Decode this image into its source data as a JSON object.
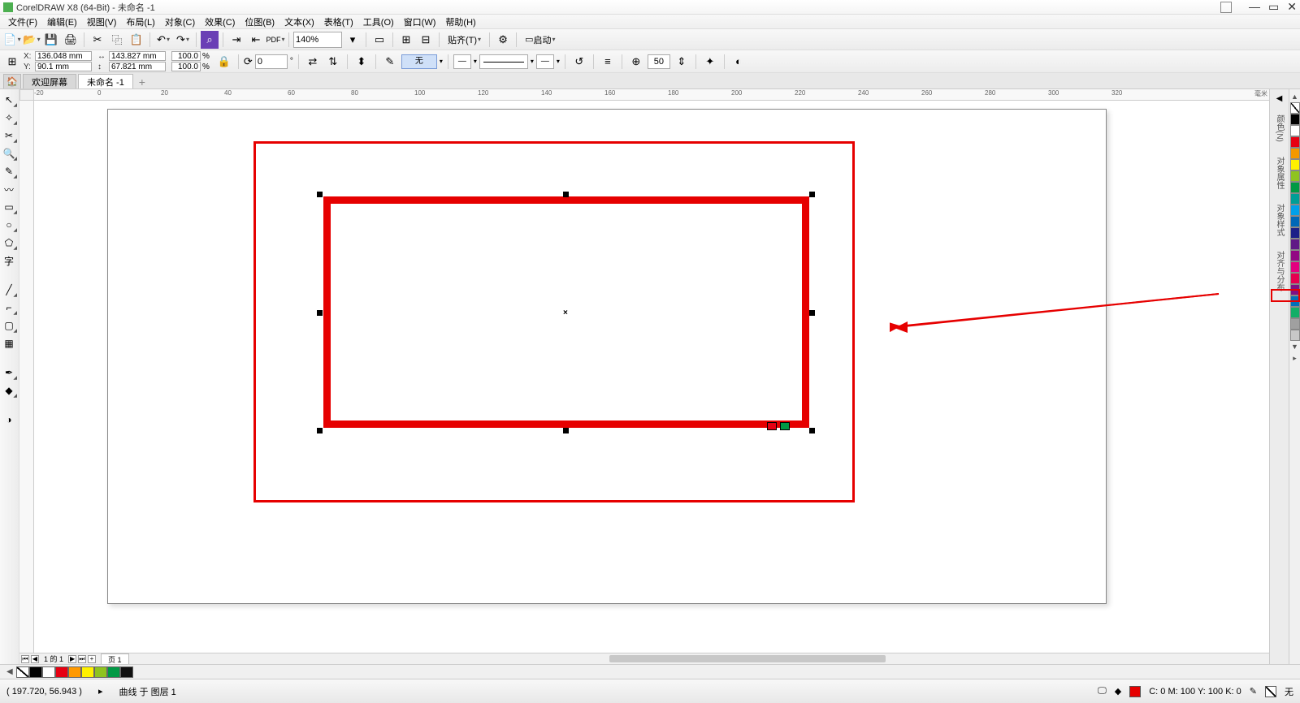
{
  "title": "CorelDRAW X8 (64-Bit) - 未命名 -1",
  "menus": [
    "文件(F)",
    "编辑(E)",
    "视图(V)",
    "布局(L)",
    "对象(C)",
    "效果(C)",
    "位图(B)",
    "文本(X)",
    "表格(T)",
    "工具(O)",
    "窗口(W)",
    "帮助(H)"
  ],
  "toolbar1": {
    "zoom": "140%",
    "snap_label": "贴齐(T)",
    "launch_label": "启动"
  },
  "prop": {
    "x": "136.048 mm",
    "y": "90.1 mm",
    "w": "143.827 mm",
    "h": "67.821 mm",
    "sx": "100.0",
    "sy": "100.0",
    "pct": "%",
    "rot": "0",
    "line_w_label": "无",
    "val50": "50"
  },
  "tabs": {
    "welcome": "欢迎屏幕",
    "doc": "未命名 -1"
  },
  "page_nav": {
    "readout": "1 的 1",
    "page_tab": "页 1"
  },
  "status": {
    "coords": "( 197.720, 56.943 )",
    "arrow": "▸",
    "hint": "曲线 于 图层 1",
    "cmyk": "C: 0 M: 100 Y: 100 K: 0",
    "none": "无"
  },
  "ruler_ticks": [
    "-20",
    "0",
    "20",
    "40",
    "60",
    "80",
    "100",
    "120",
    "140",
    "160",
    "180",
    "200",
    "220",
    "240",
    "260",
    "280",
    "300",
    "320"
  ],
  "ruler_unit": "毫米",
  "right_palette": [
    "none",
    "#000000",
    "#ffffff",
    "#e60012",
    "#f39800",
    "#fff100",
    "#8fc31f",
    "#009944",
    "#009e96",
    "#00a0e9",
    "#0068b7",
    "#1d2088",
    "#601986",
    "#920783",
    "#e4007f",
    "#e5004f",
    "#7f1084",
    "#036eb8",
    "#13ae67",
    "#a0a0a0",
    "#c8c8c8"
  ],
  "bottom_palette": [
    "none",
    "#000000",
    "#ffffff",
    "#e60012",
    "#ff9900",
    "#fff100",
    "#8fc31f",
    "#009944",
    "#111111"
  ],
  "dockers": [
    "颜色(N)",
    "对象属性",
    "对象样式",
    "对齐与分布"
  ]
}
